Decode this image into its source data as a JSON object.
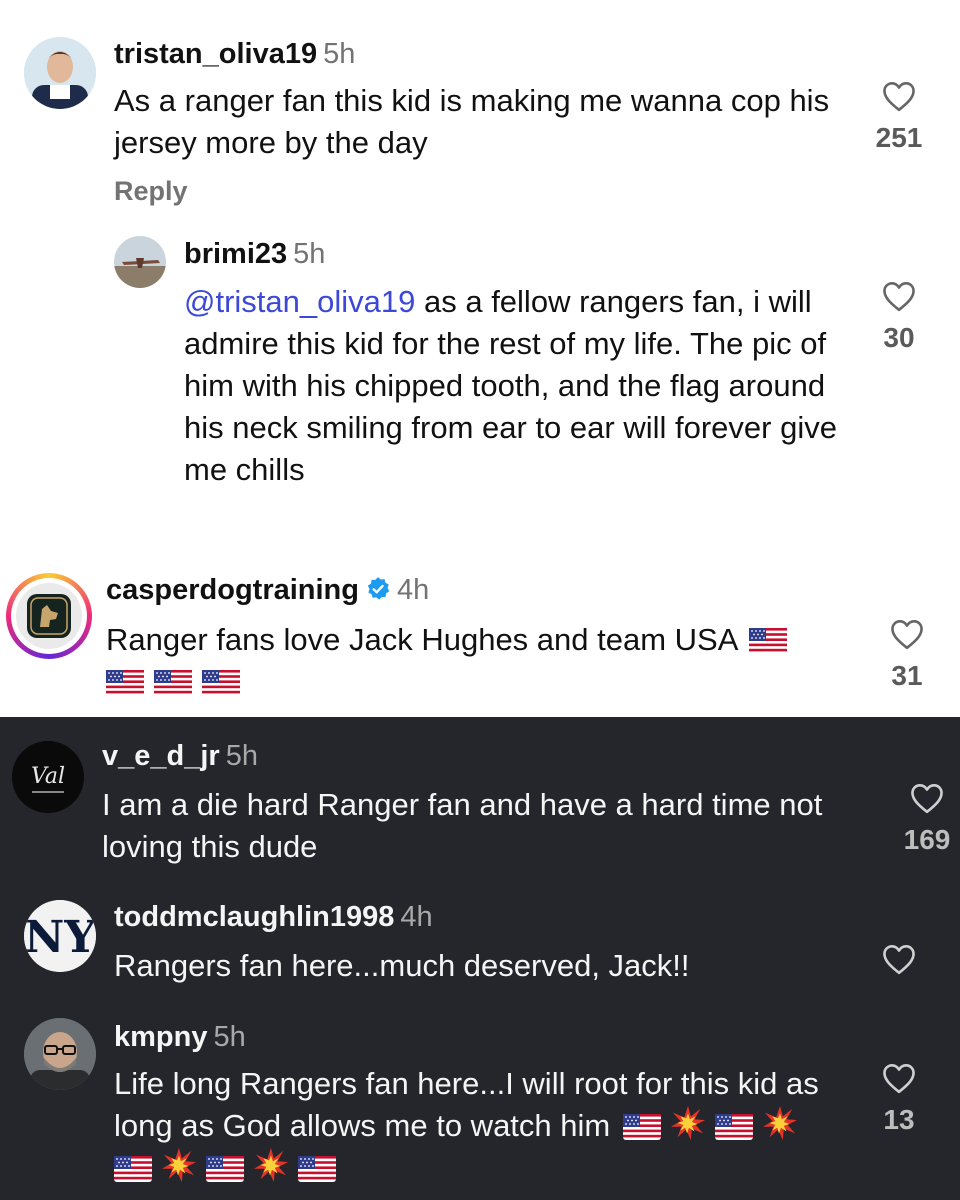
{
  "colors": {
    "light_bg": "#ffffff",
    "dark_bg": "#25262b",
    "mention": "#3b49d6",
    "verified": "#1d9bf0",
    "story_ring": [
      "#f9ce34",
      "#ee2a7b",
      "#6228d7"
    ]
  },
  "comments": [
    {
      "username": "tristan_oliva19",
      "time": "5h",
      "text": "As a ranger fan this kid is making me wanna cop his jersey more by the day",
      "likes": "251",
      "reply_label": "Reply",
      "avatar": "person-avatar"
    },
    {
      "username": "brimi23",
      "time": "5h",
      "mention": "@tristan_oliva19",
      "text": " as a fellow rangers fan, i will admire this kid for the rest of my life. The pic of him with his chipped tooth, and the flag around his neck smiling from ear to ear will forever give me chills",
      "likes": "30",
      "avatar": "airplane-avatar"
    },
    {
      "username": "casperdogtraining",
      "verified": true,
      "time": "4h",
      "text": "Ranger fans love Jack Hughes and team USA",
      "emoji": [
        "us-flag",
        "us-flag",
        "us-flag",
        "us-flag"
      ],
      "likes": "31",
      "avatar": "dog-logo-avatar"
    },
    {
      "username": "v_e_d_jr",
      "time": "5h",
      "text": "I am a die hard Ranger fan and have a hard time not loving this dude",
      "likes": "169",
      "avatar": "val-logo-avatar"
    },
    {
      "username": "toddmclaughlin1998",
      "time": "4h",
      "text": "Rangers fan here...much deserved, Jack!!",
      "likes": "",
      "avatar": "yankees-logo-avatar"
    },
    {
      "username": "kmpny",
      "time": "5h",
      "text": "Life long Rangers fan here...I will root for this kid as long as God allows me to watch him",
      "emoji": [
        "us-flag",
        "collision",
        "us-flag",
        "collision",
        "us-flag",
        "collision",
        "us-flag",
        "collision",
        "us-flag"
      ],
      "likes": "13",
      "avatar": "man-glasses-avatar"
    }
  ]
}
